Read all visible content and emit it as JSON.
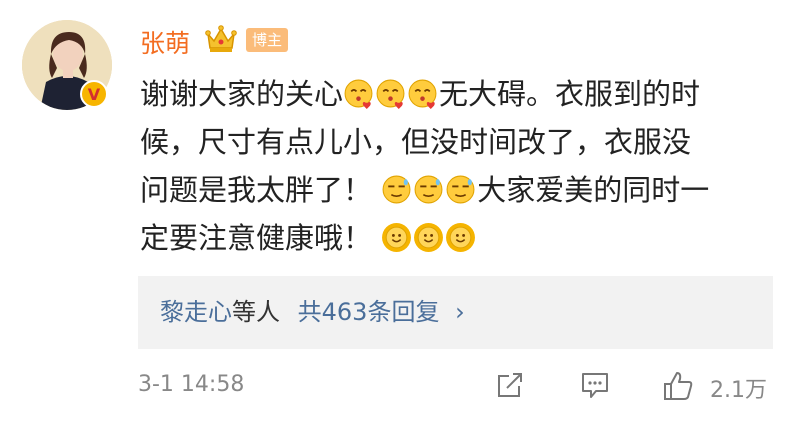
{
  "comment": {
    "author": {
      "name": "张萌",
      "badge": "博主",
      "crown_icon": "crown-icon",
      "verified_icon": "verified-v-icon",
      "verified_mark": "V",
      "name_color": "#f36d21"
    },
    "content_lines": [
      [
        {
          "t": "text",
          "v": "谢谢大家的关心"
        },
        {
          "t": "emoji",
          "v": "kiss-heart-emoji"
        },
        {
          "t": "emoji",
          "v": "kiss-heart-emoji"
        },
        {
          "t": "emoji",
          "v": "kiss-heart-emoji"
        },
        {
          "t": "text",
          "v": "无大碍。衣服到的时"
        }
      ],
      [
        {
          "t": "text",
          "v": "候，尺寸有点儿小，但没时间改了，衣服没"
        }
      ],
      [
        {
          "t": "text",
          "v": "问题是我太胖了！ "
        },
        {
          "t": "emoji",
          "v": "sweat-wink-emoji"
        },
        {
          "t": "emoji",
          "v": "sweat-wink-emoji"
        },
        {
          "t": "emoji",
          "v": "sweat-wink-emoji"
        },
        {
          "t": "text",
          "v": "大家爱美的同时一"
        }
      ],
      [
        {
          "t": "text",
          "v": "定要注意健康哦！ "
        },
        {
          "t": "emoji",
          "v": "sun-smile-emoji"
        },
        {
          "t": "emoji",
          "v": "sun-smile-emoji"
        },
        {
          "t": "emoji",
          "v": "sun-smile-emoji"
        }
      ]
    ],
    "replies": {
      "user": "黎走心",
      "suffix": "等人",
      "count_text": "共463条回复",
      "chevron": "›",
      "link_color": "#4a6e9a"
    },
    "footer": {
      "time": "3-1 14:58",
      "like_count": "2.1万",
      "icons": [
        "share-icon",
        "comment-icon",
        "like-icon"
      ]
    }
  }
}
